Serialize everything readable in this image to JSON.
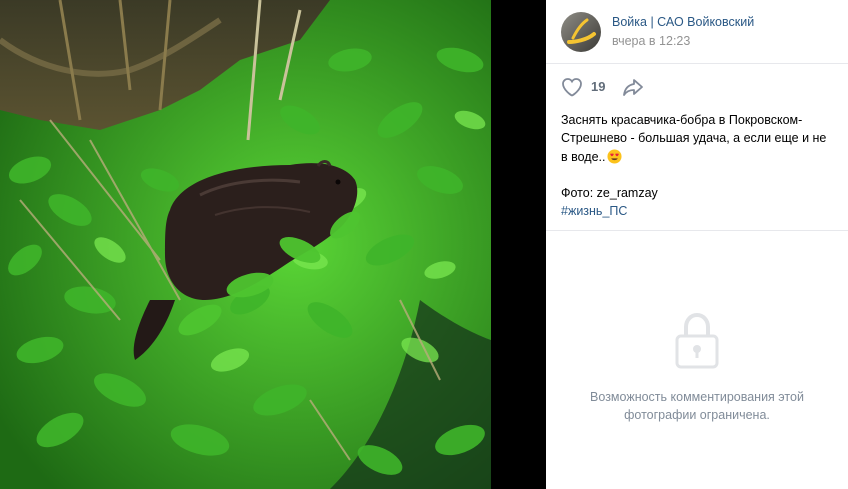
{
  "post": {
    "author": "Войка | САО Войковский",
    "time": "вчера в 12:23",
    "likes": "19",
    "text_line1": "Заснять красавчика-бобра в Покровском-Стрешнево - большая удача, а если еще и не в воде..",
    "photo_credit": "Фото: ze_ramzay",
    "hashtag": "#жизнь_ПС"
  },
  "comments": {
    "restricted_text": "Возможность комментирования этой фотографии ограничена."
  },
  "icons": {
    "like": "heart-icon",
    "share": "share-arrow-icon",
    "emoji": "heart-eyes-emoji",
    "lock": "lock-icon"
  },
  "colors": {
    "link": "#2a5885",
    "muted": "#939393",
    "icon": "#828a99",
    "border": "#e7e8ec",
    "restricted_text": "#818c99"
  }
}
